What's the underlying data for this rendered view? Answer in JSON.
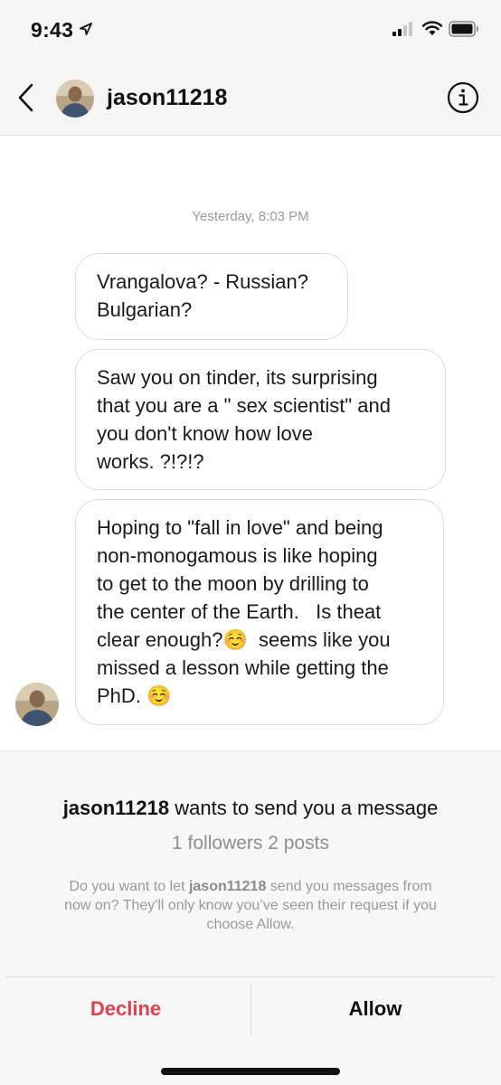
{
  "status_bar": {
    "time": "9:43",
    "icons": [
      "location-arrow-icon",
      "signal-icon",
      "wifi-icon",
      "battery-icon"
    ]
  },
  "header": {
    "username": "jason11218",
    "icons": [
      "back-chevron-icon",
      "avatar",
      "info-icon"
    ]
  },
  "chat": {
    "timestamp": "Yesterday, 8:03 PM",
    "messages": [
      {
        "text": "Vrangalova? - Russian?\nBulgarian?"
      },
      {
        "text": "Saw you on tinder, its surprising\nthat you are a \" sex scientist\" and\nyou don't know how love\nworks. ?!?!?"
      },
      {
        "text": "Hoping to \"fall in love\" and being\nnon-monogamous is like hoping\nto get to the moon by drilling to\nthe center of the Earth.   Is theat\nclear enough?☺️  seems like you\nmissed a lesson while getting the\nPhD. ☺️"
      }
    ]
  },
  "request": {
    "username": "jason11218",
    "title_suffix": "wants to send you a message",
    "stats": "1 followers  2 posts",
    "desc_prefix": "Do you want to let ",
    "desc_username": "jason11218",
    "desc_suffix": " send you messages from now on? They'll only know you’ve seen their request if you choose Allow.",
    "decline_label": "Decline",
    "allow_label": "Allow"
  },
  "colors": {
    "decline": "#e0404f",
    "header_bg": "#f5f5f5",
    "panel_bg": "#f7f7f7",
    "muted_text": "#999999"
  }
}
